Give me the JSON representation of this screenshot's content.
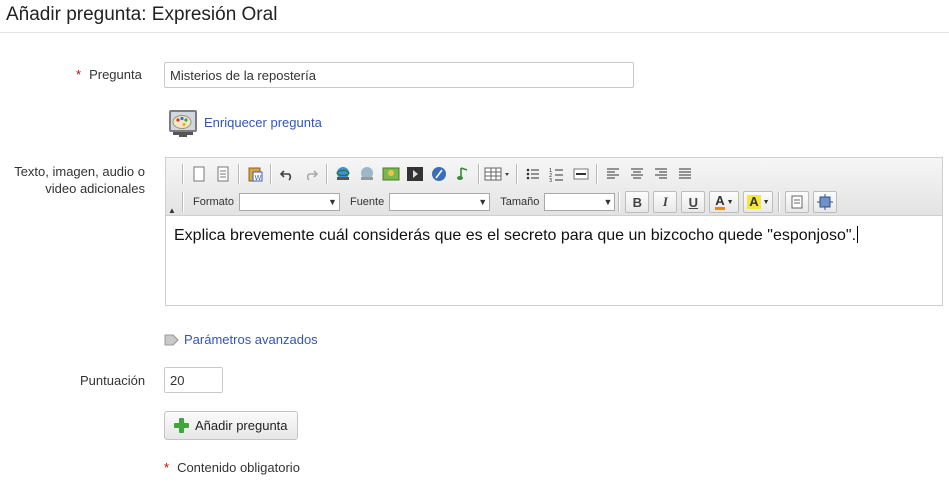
{
  "page": {
    "title": "Añadir pregunta: Expresión Oral"
  },
  "form": {
    "required_mark": "*",
    "question_label": "Pregunta",
    "question_value": "Misterios de la repostería",
    "enrich_link": "Enriquecer pregunta",
    "additional_label_line1": "Texto, imagen, audio o",
    "additional_label_line2": "video adicionales",
    "advanced_link": "Parámetros avanzados",
    "score_label": "Puntuación",
    "score_value": "20",
    "add_button": "Añadir pregunta",
    "required_note": "Contenido obligatorio"
  },
  "editor": {
    "toolbar": {
      "format_label": "Formato",
      "font_label": "Fuente",
      "size_label": "Tamaño",
      "bold": "B",
      "italic": "I",
      "underline": "U",
      "font_color_letter": "A",
      "highlight_letter": "A"
    },
    "content": "Explica brevemente cuál considerás que es el secreto para que un bizcocho quede \"esponjoso\"."
  },
  "colors": {
    "link": "#3155b8",
    "required": "#cc0000",
    "add_icon": "#3fa63a"
  }
}
